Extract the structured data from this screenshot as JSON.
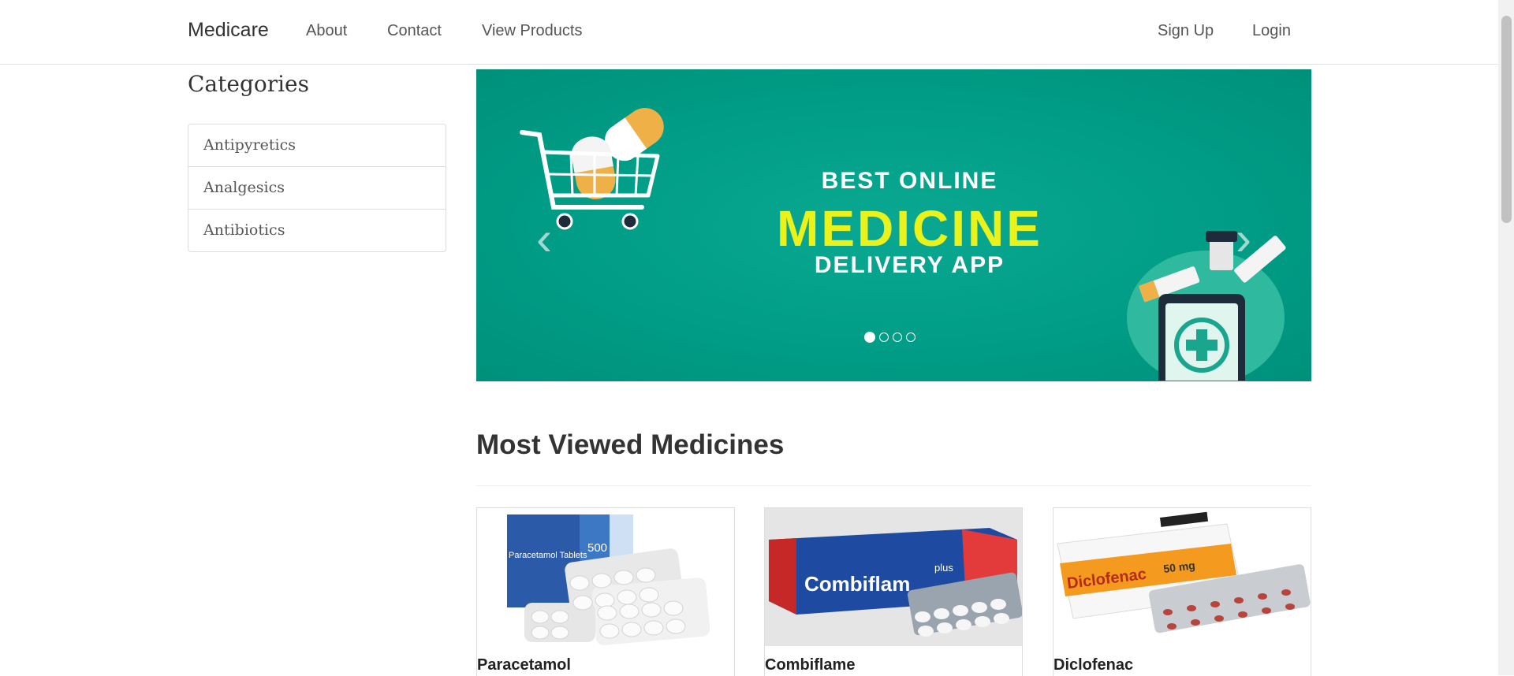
{
  "navbar": {
    "brand": "Medicare",
    "links": [
      "About",
      "Contact",
      "View Products"
    ],
    "right_links": [
      "Sign Up",
      "Login"
    ]
  },
  "categories": {
    "title": "Categories",
    "items": [
      "Antipyretics",
      "Analgesics",
      "Antibiotics"
    ]
  },
  "carousel": {
    "line1": "BEST ONLINE",
    "line2": "MEDICINE",
    "line3": "DELIVERY APP",
    "active_slide": 1,
    "slide_count": 4,
    "prev_icon": "chevron-left-icon",
    "next_icon": "chevron-right-icon"
  },
  "section": {
    "title": "Most Viewed Medicines"
  },
  "products": [
    {
      "name": "Paracetamol",
      "box_text": "Paracetamol Tablets",
      "dose": "500"
    },
    {
      "name": "Combiflame",
      "box_text": "Combiflam",
      "dose": "plus"
    },
    {
      "name": "Diclofenac",
      "box_text": "Diclofenac",
      "dose": "50 mg"
    }
  ],
  "colors": {
    "banner": "#009c85",
    "banner_accent": "#e9f21a"
  }
}
